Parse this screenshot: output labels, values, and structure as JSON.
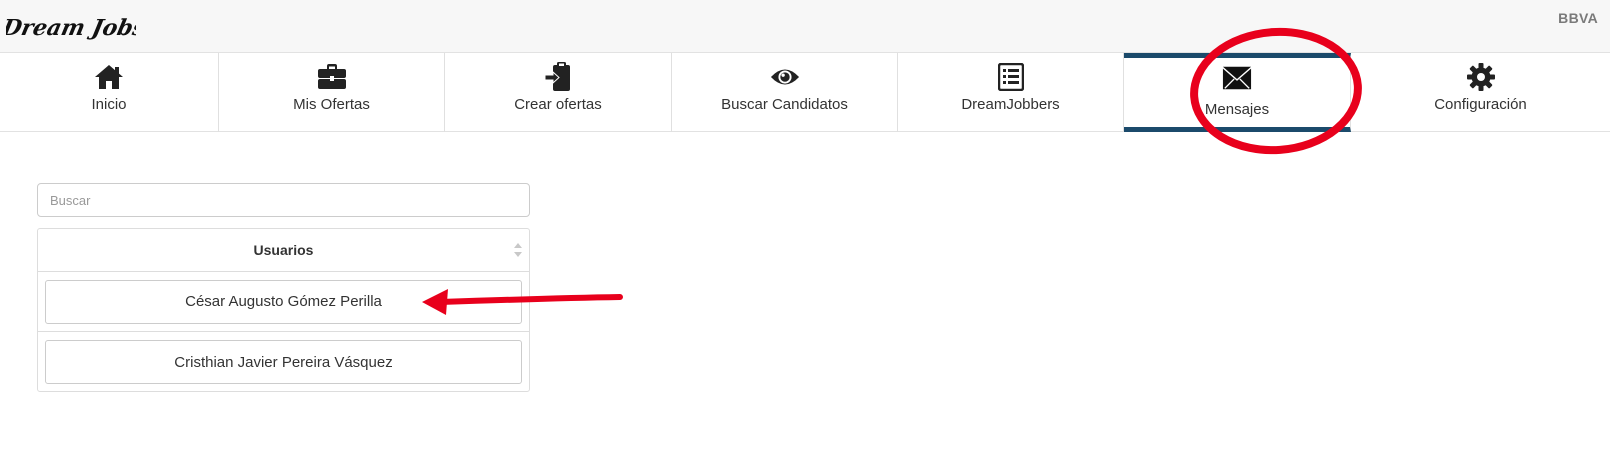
{
  "header": {
    "logo_text": "Dream Jobs",
    "company": "BBVA"
  },
  "nav": {
    "items": [
      {
        "label": "Inicio",
        "icon": "home-icon"
      },
      {
        "label": "Mis Ofertas",
        "icon": "briefcase-icon"
      },
      {
        "label": "Crear ofertas",
        "icon": "clipboard-icon"
      },
      {
        "label": "Buscar Candidatos",
        "icon": "eye-icon"
      },
      {
        "label": "DreamJobbers",
        "icon": "list-icon"
      },
      {
        "label": "Mensajes",
        "icon": "envelope-icon",
        "active": true
      },
      {
        "label": "Configuración",
        "icon": "gear-icon"
      }
    ]
  },
  "search": {
    "placeholder": "Buscar",
    "value": ""
  },
  "users_table": {
    "header": "Usuarios",
    "rows": [
      {
        "name": "César Augusto Gómez Perilla"
      },
      {
        "name": "Cristhian Javier Pereira Vásquez"
      }
    ]
  },
  "colors": {
    "active_tab_border": "#1b4a6b",
    "annotation_red": "#e8001c"
  }
}
